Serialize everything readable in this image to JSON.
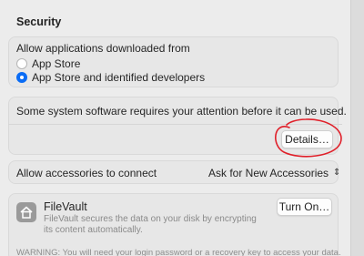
{
  "security": {
    "title": "Security",
    "allow_apps_label": "Allow applications downloaded from",
    "options": [
      {
        "label": "App Store",
        "selected": false
      },
      {
        "label": "App Store and identified developers",
        "selected": true
      }
    ]
  },
  "system_software": {
    "message": "Some system software requires your attention before it can be used.",
    "details_button": "Details…"
  },
  "accessories": {
    "label": "Allow accessories to connect",
    "value": "Ask for New Accessories"
  },
  "filevault": {
    "title": "FileVault",
    "description": "FileVault secures the data on your disk by encrypting its content automatically.",
    "button": "Turn On…",
    "warning": "WARNING: You will need your login password or a recovery key to access your data."
  },
  "colors": {
    "accent": "#0a6cf5",
    "annotation": "#e0202a"
  }
}
